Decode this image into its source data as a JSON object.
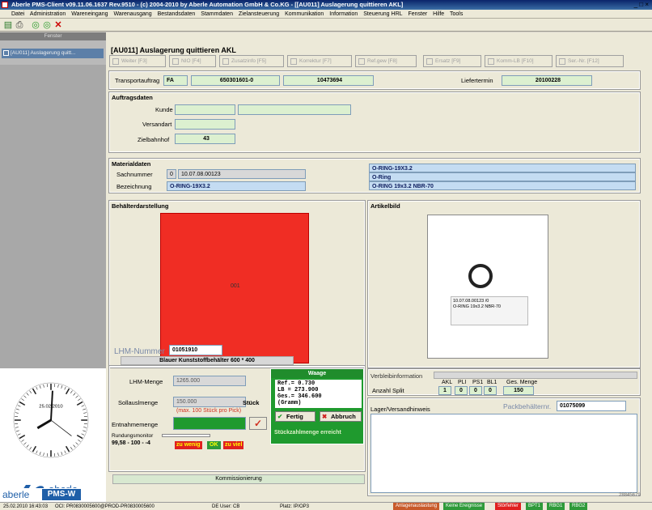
{
  "window": {
    "title": "Aberle PMS-Client v09.11.06.1637 Rev.9510 - (c) 2004-2010 by Aberle Automation GmbH & Co.KG - [[AU011] Auslagerung quittieren AKL]",
    "controls": "_ □ ×"
  },
  "menu": [
    "Datei",
    "Administration",
    "Wareneingang",
    "Warenausgang",
    "Bestandsdaten",
    "Stammdaten",
    "Zielansteuerung",
    "Kommunikation",
    "Information",
    "Steuerung HRL",
    "Fenster",
    "Hilfe",
    "Tools"
  ],
  "toolbar": {
    "icons": [
      "home-icon",
      "print-icon",
      "refresh-icon",
      "refresh-alt-icon",
      "close-icon"
    ]
  },
  "sidebar": {
    "header": "Fenster",
    "item": "[AU011] Auslagerung quitt...",
    "clock_date": "25.02.2010",
    "logo_text": "aberle",
    "logo_sub": "automation",
    "bottom_logo_left": "aberle",
    "bottom_logo_right": "PMS-W"
  },
  "form": {
    "title": "[AU011] Auslagerung quittieren AKL",
    "buttons": [
      {
        "label": "Weiter [F3]"
      },
      {
        "label": "NIO [F4]"
      },
      {
        "label": "Zusatzinfo [F5]"
      },
      {
        "label": "Korrektur [F7]"
      },
      {
        "label": "Ref.gew [F8]"
      },
      {
        "label": "Ersatz [F9]"
      },
      {
        "label": "Komm-LB [F10]"
      },
      {
        "label": "Ser.-Nr. [F12]"
      }
    ],
    "transport_label": "Transportauftrag",
    "transport_type": "FA",
    "transport_no": "650301601-0",
    "transport_id": "10473694",
    "liefertermin_label": "Liefertermin",
    "liefertermin": "20100228",
    "auftragsdaten_title": "Auftragsdaten",
    "kunde_label": "Kunde",
    "kunde_value": "",
    "kunde_value2": "",
    "versandart_label": "Versandart",
    "versandart_value": "",
    "zielbahnhof_label": "Zielbahnhof",
    "zielbahnhof_value": "43",
    "materialdaten_title": "Materialdaten",
    "sachnummer_label": "Sachnummer",
    "sachnummer_prefix": "0",
    "sachnummer": "10.07.08.00123",
    "bezeichnung_label": "Bezeichnung",
    "bezeichnung": "O-RING-19X3.2",
    "mat_right1": "O-RING-19X3.2",
    "mat_right2": "O-Ring",
    "mat_right3": "O-RING 19x3.2 NBR-70",
    "behaelter_title": "Behälterdarstellung",
    "behaelter_slot": "001",
    "artikelbild_title": "Artikelbild",
    "photo_label1": "10.07.08.00123 /0",
    "photo_label2": "O-RING 19x3.2 NBR-70",
    "lhm_label": "LHM-Nummer",
    "lhm_value": "01051910",
    "lhm_desc": "Blauer Kunststoffbehälter 600 * 400",
    "lhm_menge_label": "LHM-Menge",
    "lhm_menge": "1265.000",
    "soll_label": "Sollauslmenge",
    "soll_value": "150.000",
    "soll_unit": "Stück",
    "max_hint": "(max. 100 Stück pro Pick)",
    "entnahme_label": "Entnahmemenge",
    "rundung_label": "Rundungsmonitor",
    "rundung_value": "99,58 - 100 - -4",
    "zu_wenig": "zu wenig",
    "ok": "OK",
    "zu_viel": "zu viel",
    "waage_title": "Waage",
    "waage_lines": [
      "Ref.=      0.730",
      "LB  =    273.900",
      "Ges.=    346.600",
      "       (Gramm)"
    ],
    "fertig": "Fertig",
    "abbruch": "Abbruch",
    "stueck_msg": "Stückzahlmenge erreicht",
    "kommissionierung": "Kommissionierung",
    "verbleib_label": "Verbleibinformation",
    "anzahl_split_label": "Anzahl Split",
    "split_headers": [
      "AKL",
      "PLI",
      "PS1",
      "BL1",
      "Ges. Menge"
    ],
    "split_values": [
      "1",
      "0",
      "0",
      "0",
      "150"
    ],
    "lager_label": "Lager/Versandhinweis",
    "packbehaelter_label": "Packbehälternr.",
    "packbehaelter_value": "01075099",
    "right_code": "28845679"
  },
  "status": {
    "datetime": "25.02.2010 16:43:03",
    "oci": "OCI: PR0830005600@PROD-PR0830005600",
    "user": "DE  User: CB",
    "platz": "Platz: IP/OP3",
    "tags": [
      {
        "label": "Anlagenauslastung",
        "color": "#c85a2a"
      },
      {
        "label": "Keine Ereignisse",
        "color": "#2e9a3a"
      },
      {
        "label": "Störfehler",
        "color": "#e02020"
      },
      {
        "label": "BPT1",
        "color": "#2e9a3a"
      },
      {
        "label": "RBG1",
        "color": "#2e9a3a"
      },
      {
        "label": "RBG2",
        "color": "#2e9a3a"
      }
    ]
  },
  "colors": {
    "accent": "#0a246a",
    "red": "#f02d24",
    "green": "#1f9a2e"
  }
}
